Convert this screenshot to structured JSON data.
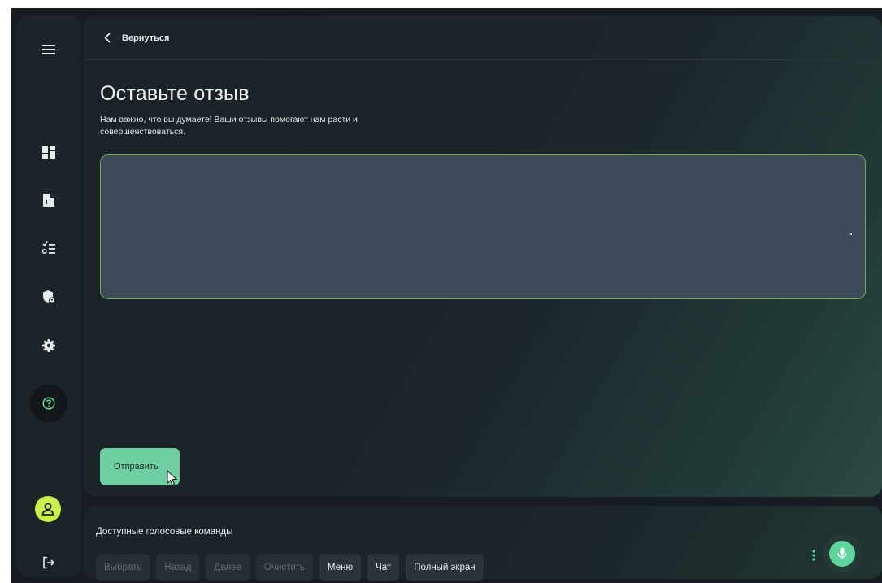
{
  "header": {
    "back_label": "Вернуться"
  },
  "feedback": {
    "title": "Оставьте отзыв",
    "subtitle": "Нам важно, что вы думаете! Ваши отзывы помогают нам расти и совершенствоваться.",
    "textarea_value": "",
    "submit_label": "Отправить"
  },
  "sidebar": {
    "items": [
      {
        "icon": "menu-icon"
      },
      {
        "icon": "dashboard-icon"
      },
      {
        "icon": "document-icon"
      },
      {
        "icon": "checklist-icon"
      },
      {
        "icon": "shield-user-icon"
      },
      {
        "icon": "gear-icon"
      },
      {
        "icon": "help-icon",
        "active": true
      }
    ],
    "avatar_color": "#c9f04f"
  },
  "voice": {
    "title": "Доступные голосовые команды",
    "commands": [
      {
        "label": "Выбрать",
        "enabled": false
      },
      {
        "label": "Назад",
        "enabled": false
      },
      {
        "label": "Далее",
        "enabled": false
      },
      {
        "label": "Очистить",
        "enabled": false
      },
      {
        "label": "Меню",
        "enabled": true
      },
      {
        "label": "Чат",
        "enabled": true
      },
      {
        "label": "Полный экран",
        "enabled": true
      }
    ]
  },
  "colors": {
    "accent": "#6fcfa3",
    "mic": "#5fd59b",
    "input_border": "#77a84a",
    "background": "#161c22"
  }
}
